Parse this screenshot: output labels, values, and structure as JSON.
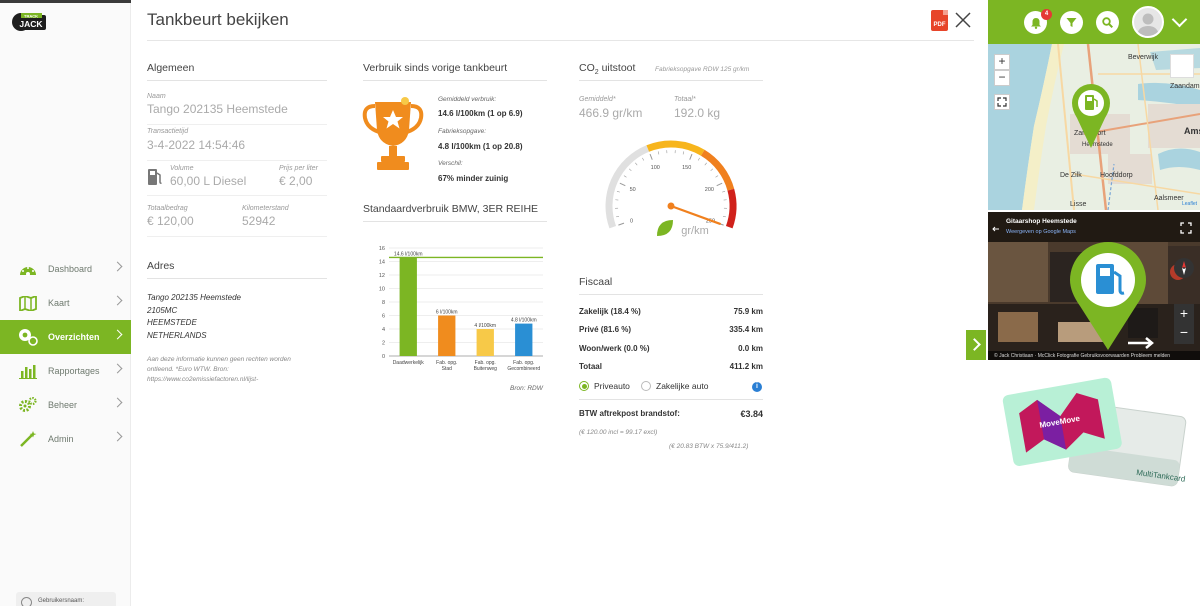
{
  "app": {
    "logo_text": "TRACK JACK",
    "page_title": "Tankbeurt bekijken",
    "pdf_label": "PDF"
  },
  "sidebar": {
    "items": [
      {
        "label": "Dashboard",
        "icon": "dashboard-icon"
      },
      {
        "label": "Kaart",
        "icon": "map-icon"
      },
      {
        "label": "Overzichten",
        "icon": "overview-icon",
        "active": true
      },
      {
        "label": "Rapportages",
        "icon": "chart-icon"
      },
      {
        "label": "Beheer",
        "icon": "gears-icon"
      },
      {
        "label": "Admin",
        "icon": "wand-icon"
      }
    ],
    "user_label": "Gebruikersnaam:"
  },
  "algemeen": {
    "title": "Algemeen",
    "naam_label": "Naam",
    "naam": "Tango 202135 Heemstede",
    "transactie_label": "Transactietijd",
    "transactie": "3-4-2022 14:54:46",
    "volume_label": "Volume",
    "volume": "60,00 L Diesel",
    "prijs_label": "Prijs per liter",
    "prijs": "€ 2,00",
    "totaal_label": "Totaalbedrag",
    "totaal": "€ 120,00",
    "km_label": "Kilometerstand",
    "km": "52942"
  },
  "adres": {
    "title": "Adres",
    "line1": "Tango 202135 Heemstede",
    "line2": "2105MC",
    "line3": "HEEMSTEDE",
    "line4": "NETHERLANDS",
    "disclaimer1": "Aan deze informatie kunnen geen rechten worden",
    "disclaimer2": "ontleend. *Euro WTW. Bron:",
    "disclaimer3": "https://www.co2emissiefactoren.nl/lijst-"
  },
  "verbruik": {
    "title": "Verbruik sinds vorige tankbeurt",
    "gem_label": "Gemiddeld verbruik:",
    "gem": "14.6 l/100km (1 op 6.9)",
    "fab_label": "Fabrieksopgave:",
    "fab": "4.8 l/100km (1 op 20.8)",
    "verschil_label": "Verschil:",
    "verschil": "67% minder zuinig"
  },
  "standaard": {
    "title": "Standaardverbruik BMW, 3ER REIHE",
    "source": "Bron: RDW"
  },
  "chart_data": {
    "type": "bar",
    "categories": [
      "Daadwerkelijk",
      "Fab. opg. Stad",
      "Fab. opg. Buitenweg",
      "Fab. opg. Gecombineerd"
    ],
    "values": [
      14.6,
      6,
      4,
      4.8
    ],
    "data_labels": [
      "14.6 l/100km",
      "6 l/100km",
      "4 l/100km",
      "4.8 l/100km"
    ],
    "colors": [
      "#7cb623",
      "#f08c1e",
      "#f7c948",
      "#2a8fd4"
    ],
    "reference_line": 14.6,
    "reference_color": "#7cb623",
    "yticks": [
      "0",
      "2",
      "4",
      "6",
      "8",
      "10",
      "12",
      "14",
      "16"
    ],
    "ylim": [
      0,
      16
    ],
    "xlabel": "",
    "ylabel": ""
  },
  "co2": {
    "title": "CO",
    "title_sub": "2",
    "title_rest": " uitstoot",
    "fab_note": "Fabrieksopgave RDW 125 gr/km",
    "gem_label": "Gemiddeld*",
    "gem": "466.9 gr/km",
    "totaal_label": "Totaal*",
    "totaal": "192.0 kg",
    "gauge_unit": "gr/km",
    "gauge_ticks": [
      "0",
      "50",
      "100",
      "150",
      "200",
      "250"
    ],
    "gauge_value": 466.9,
    "gauge_max": 250
  },
  "fiscaal": {
    "title": "Fiscaal",
    "rows": [
      {
        "label": "Zakelijk (18.4 %)",
        "value": "75.9 km"
      },
      {
        "label": "Privé (81.6 %)",
        "value": "335.4 km"
      },
      {
        "label": "Woon/werk (0.0 %)",
        "value": "0.0 km"
      },
      {
        "label": "Totaal",
        "value": "411.2 km"
      }
    ],
    "radio_prive": "Priveauto",
    "radio_zakelijk": "Zakelijke auto",
    "btw_label": "BTW aftrekpost brandstof:",
    "btw_value": "€3.84",
    "note1": "(€ 120.00 incl = 99.17 excl)",
    "note2": "(€ 20.83 BTW x 75.9/411.2)"
  },
  "rightpanel": {
    "notification_count": "4",
    "map_places": [
      "Beverwijk",
      "Zaandam",
      "Zandvoort",
      "Heemstede",
      "Ams",
      "De Zilk",
      "Hoofddorp",
      "Aalsmeer",
      "Lisse",
      "Leaflet"
    ],
    "street_title": "Gitaarshop Heemstede",
    "street_sub": "Weergeven op Google Maps",
    "street_footer": "© Jack Christiaan · McClick Fotografie   Gebruiksvoorwaarden   Probleem melden",
    "card1": "MoveMove",
    "card2": "MultiTankcard"
  }
}
